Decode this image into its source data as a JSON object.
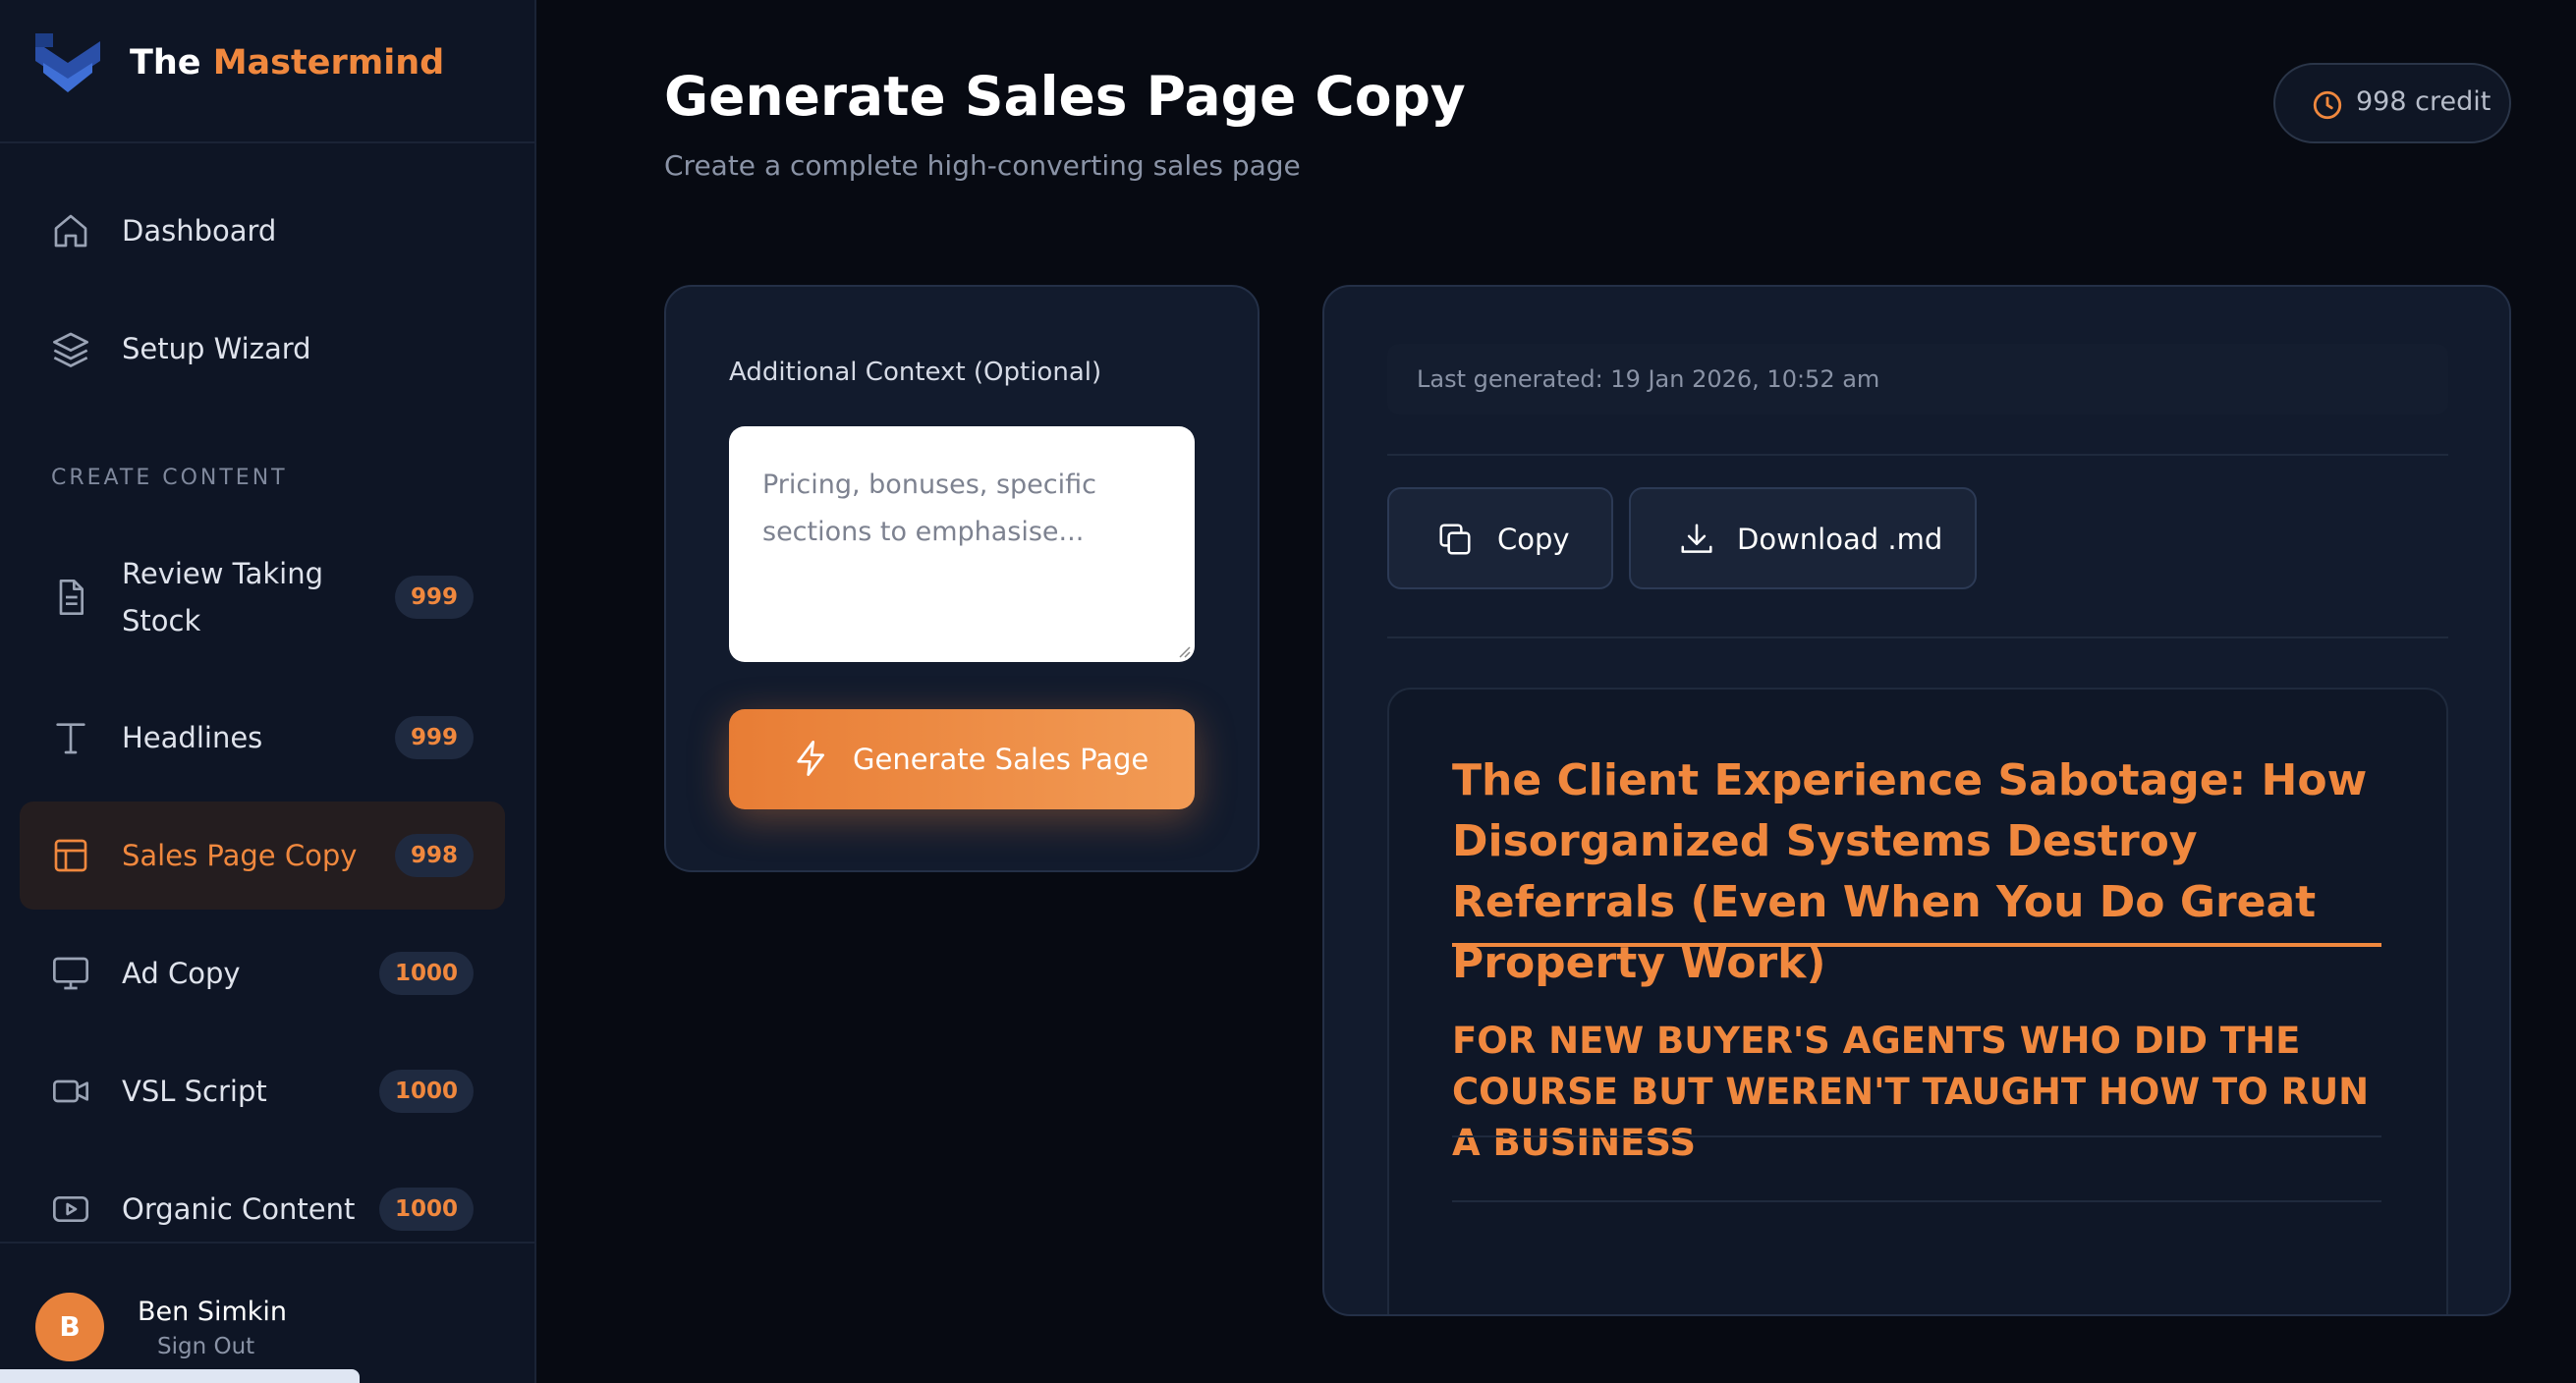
{
  "brand": {
    "name_part1": "The ",
    "name_part2": "Mastermind"
  },
  "sidebar": {
    "section_label": "CREATE CONTENT",
    "items": [
      {
        "label": "Dashboard",
        "icon": "home-icon"
      },
      {
        "label": "Setup Wizard",
        "icon": "layers-icon"
      },
      {
        "label": "Review Taking Stock",
        "icon": "document-icon",
        "badge": "999"
      },
      {
        "label": "Headlines",
        "icon": "type-icon",
        "badge": "999"
      },
      {
        "label": "Sales Page Copy",
        "icon": "layout-icon",
        "badge": "998",
        "active": true
      },
      {
        "label": "Ad Copy",
        "icon": "monitor-icon",
        "badge": "1000"
      },
      {
        "label": "VSL Script",
        "icon": "video-icon",
        "badge": "1000"
      },
      {
        "label": "Organic Content",
        "icon": "youtube-icon",
        "badge": "1000"
      }
    ]
  },
  "user": {
    "initial": "B",
    "name": "Ben Simkin",
    "signout": "Sign Out"
  },
  "header": {
    "title": "Generate Sales Page Copy",
    "subtitle": "Create a complete high-converting sales page",
    "credits": "998 credit"
  },
  "form": {
    "label": "Additional Context (Optional)",
    "placeholder": "Pricing, bonuses, specific sections to emphasise...",
    "value": "",
    "generate_label": "Generate Sales Page"
  },
  "output": {
    "last_generated": "Last generated: 19 Jan 2026, 10:52 am",
    "copy_label": "Copy",
    "download_label": "Download .md",
    "headline": "The Client Experience Sabotage: How Disorganized Systems Destroy Referrals (Even When You Do Great Property Work)",
    "subheadline": "FOR NEW BUYER'S AGENTS WHO DID THE COURSE BUT WEREN'T TAUGHT HOW TO RUN A BUSINESS"
  },
  "colors": {
    "accent": "#f0883e",
    "background": "#070a12",
    "sidebar": "#0e1525",
    "card": "#121b2d"
  }
}
